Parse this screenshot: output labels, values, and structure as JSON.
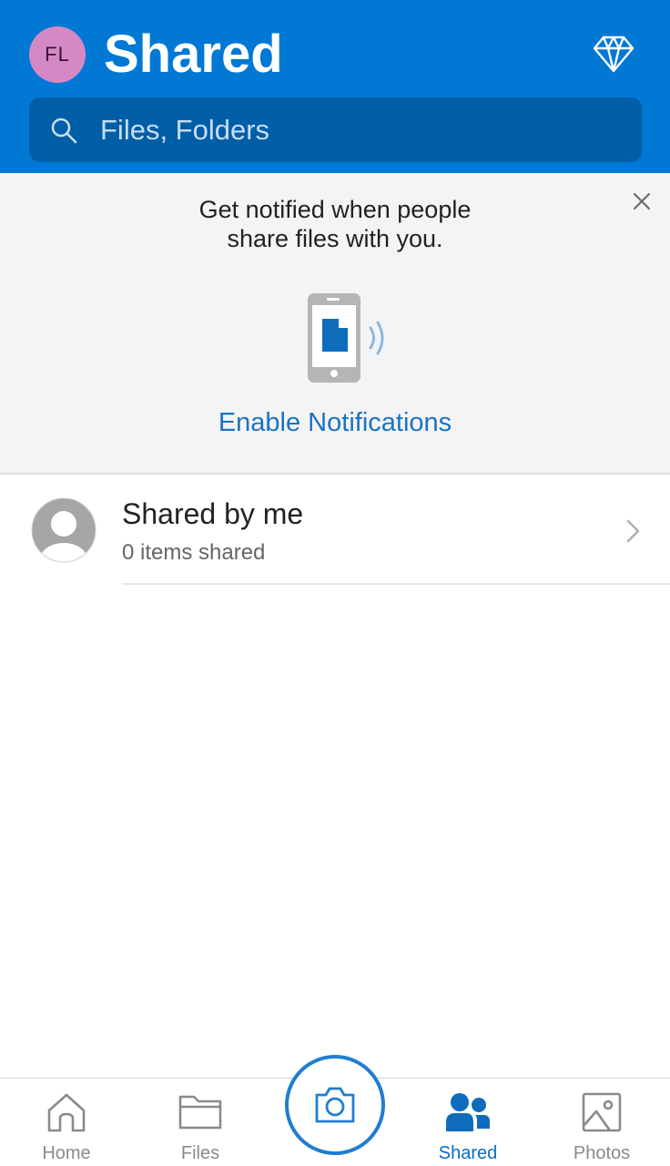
{
  "header": {
    "avatar_initials": "FL",
    "title": "Shared",
    "premium_icon": "diamond-icon"
  },
  "search": {
    "placeholder": "Files, Folders",
    "icon": "search-icon"
  },
  "banner": {
    "message_line1": "Get notified when people",
    "message_line2": "share files with you.",
    "action_label": "Enable Notifications",
    "close_icon": "close-icon"
  },
  "list": {
    "items": [
      {
        "title": "Shared by me",
        "subtitle": "0 items shared",
        "icon": "person-icon"
      }
    ]
  },
  "tabbar": {
    "tabs": [
      {
        "label": "Home",
        "icon": "home-icon",
        "active": false
      },
      {
        "label": "Files",
        "icon": "folder-icon",
        "active": false
      },
      {
        "label": "Shared",
        "icon": "people-icon",
        "active": true
      },
      {
        "label": "Photos",
        "icon": "image-icon",
        "active": false
      }
    ],
    "camera_icon": "camera-icon"
  },
  "colors": {
    "brand": "#0078d4",
    "search_bg": "#005ea7",
    "avatar_bg": "#d589c4",
    "link": "#1a73c4",
    "active_tab": "#0f6cbd",
    "inactive_tab": "#8a8a8a"
  }
}
